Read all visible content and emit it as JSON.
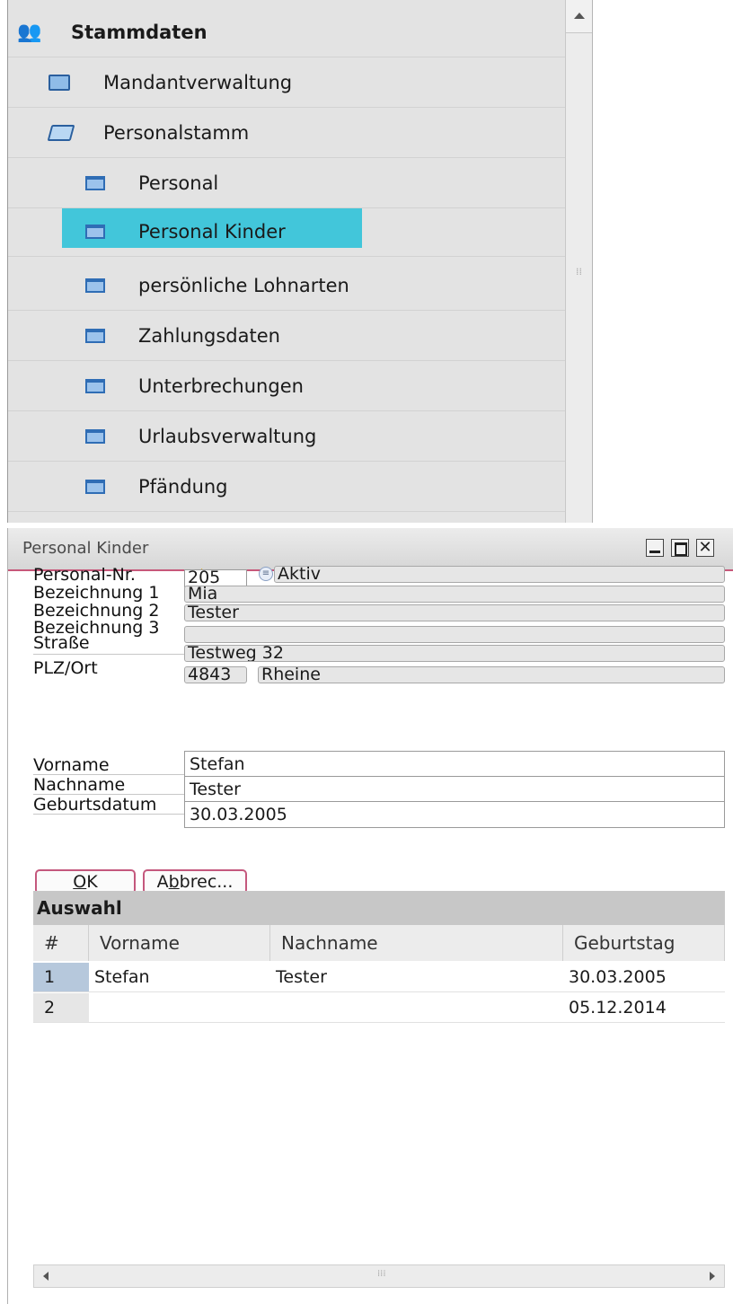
{
  "tree": {
    "root_label": "Stammdaten",
    "items": [
      {
        "label": "Mandantverwaltung",
        "icon": "folder-closed-icon"
      },
      {
        "label": "Personalstamm",
        "icon": "folder-open-icon"
      },
      {
        "label": "Personal",
        "icon": "form-icon"
      },
      {
        "label": "Personal Kinder",
        "icon": "form-icon",
        "selected": true
      },
      {
        "label": "persönliche Lohnarten",
        "icon": "form-icon"
      },
      {
        "label": "Zahlungsdaten",
        "icon": "form-icon"
      },
      {
        "label": "Unterbrechungen",
        "icon": "form-icon"
      },
      {
        "label": "Urlaubsverwaltung",
        "icon": "form-icon"
      },
      {
        "label": "Pfändung",
        "icon": "form-icon"
      }
    ],
    "selection_color": "#42c6da"
  },
  "window": {
    "title": "Personal Kinder",
    "controls": [
      "minimize",
      "maximize",
      "close"
    ],
    "close_glyph": "✕"
  },
  "header_fields": {
    "personal_nr": {
      "label": "Personal-Nr.",
      "value": "205",
      "status": "Aktiv"
    },
    "bezeichnung1": {
      "label": "Bezeichnung 1",
      "value": "Mia"
    },
    "bezeichnung2": {
      "label": "Bezeichnung 2",
      "value": "Tester"
    },
    "bezeichnung3": {
      "label": "Bezeichnung 3",
      "value": ""
    },
    "strasse": {
      "label": "Straße",
      "value": "Testweg 32"
    },
    "plz_ort": {
      "label": "PLZ/Ort",
      "plz": "4843",
      "ort": "Rheine"
    }
  },
  "child_fields": {
    "vorname": {
      "label": "Vorname",
      "value": "Stefan"
    },
    "nachname": {
      "label": "Nachname",
      "value": "Tester"
    },
    "geburtsdatum": {
      "label": "Geburtsdatum",
      "value": "30.03.2005"
    }
  },
  "buttons": {
    "ok": {
      "mnemonic": "O",
      "rest": "K"
    },
    "cancel": {
      "prefix": "A",
      "mnemonic": "b",
      "rest": "brec..."
    }
  },
  "grid": {
    "title": "Auswahl",
    "columns": [
      "#",
      "Vorname",
      "Nachname",
      "Geburtstag"
    ],
    "rows": [
      {
        "n": "1",
        "vorname": "Stefan",
        "nachname": "Tester",
        "geburtstag": "30.03.2005"
      },
      {
        "n": "2",
        "vorname": "",
        "nachname": "",
        "geburtstag": "05.12.2014"
      }
    ]
  },
  "colors": {
    "accent": "#c4587d",
    "panel_bg": "#e3e3e3"
  }
}
